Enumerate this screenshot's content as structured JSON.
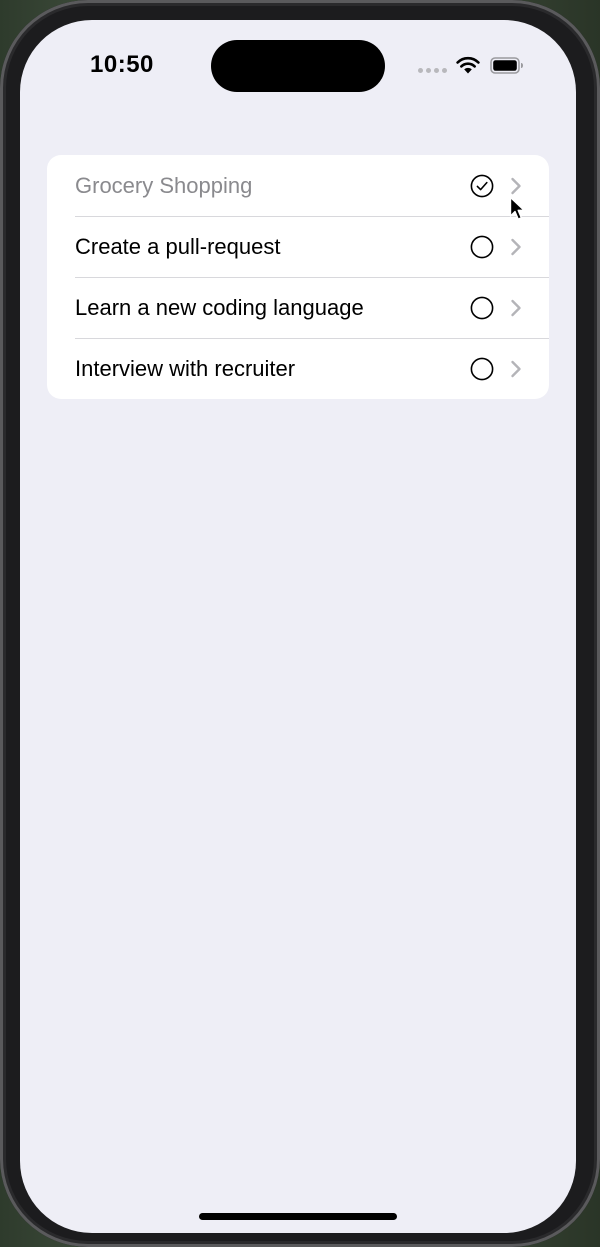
{
  "status_bar": {
    "time": "10:50"
  },
  "todo_list": {
    "items": [
      {
        "label": "Grocery Shopping",
        "completed": true
      },
      {
        "label": "Create a pull-request",
        "completed": false
      },
      {
        "label": "Learn a new coding language",
        "completed": false
      },
      {
        "label": "Interview with recruiter",
        "completed": false
      }
    ]
  },
  "icons": {
    "completed": "checkmark-circle-icon",
    "incomplete": "empty-circle-icon",
    "disclosure": "chevron-right-icon"
  },
  "colors": {
    "background": "#eeeef6",
    "card": "#ffffff",
    "completed_text": "#8a8a8e",
    "chevron": "#b4b4b8"
  }
}
